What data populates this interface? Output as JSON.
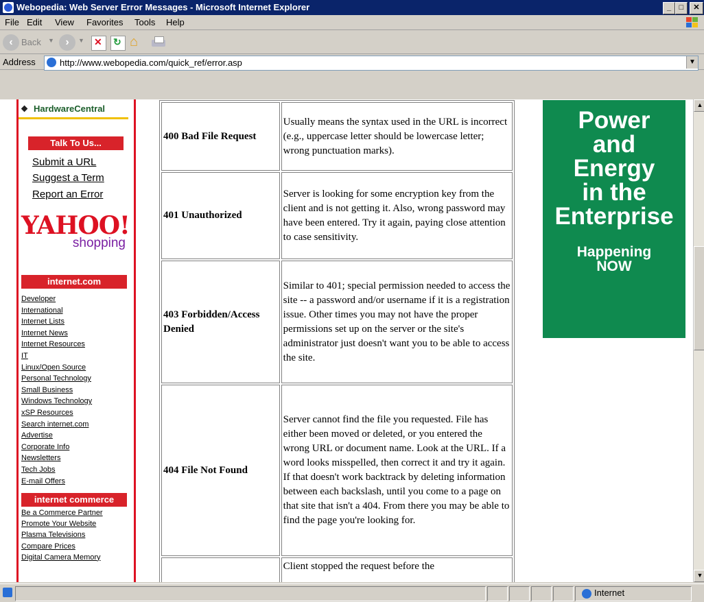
{
  "window": {
    "title": "Webopedia: Web Server Error Messages - Microsoft Internet Explorer"
  },
  "menu": [
    "File",
    "Edit",
    "View",
    "Favorites",
    "Tools",
    "Help"
  ],
  "toolbar": {
    "back_label": "Back"
  },
  "address": {
    "label": "Address",
    "url": "http://www.webopedia.com/quick_ref/error.asp"
  },
  "sidebar": {
    "hwc": "HardwareCentral",
    "talk_header": "Talk To Us...",
    "talk_links": [
      "Submit a URL",
      "Suggest a Term",
      "Report an Error"
    ],
    "yahoo": "YAHOO!",
    "yahoo_sub": "shopping",
    "internet_header": "internet.com",
    "internet_links": [
      "Developer",
      "International",
      "Internet Lists",
      "Internet News",
      "Internet Resources",
      "IT",
      "Linux/Open Source",
      "Personal Technology",
      "Small Business",
      "Windows Technology",
      "xSP Resources",
      "Search internet.com",
      "Advertise",
      "Corporate Info",
      "Newsletters",
      "Tech Jobs",
      "E-mail Offers"
    ],
    "commerce_header": "internet commerce",
    "commerce_links": [
      "Be a Commerce Partner",
      "Promote Your Website",
      "Plasma Televisions",
      "Compare Prices",
      "Digital Camera Memory"
    ]
  },
  "errors": [
    {
      "code": "400 Bad File Request",
      "desc": "Usually means the syntax used in the URL is incorrect (e.g., uppercase letter should be lowercase letter; wrong punctuation marks)."
    },
    {
      "code": "401 Unauthorized",
      "desc": "Server is looking for some encryption key from the client and is not getting it. Also, wrong password may have been entered. Try it again, paying close attention to case sensitivity."
    },
    {
      "code": "403 Forbidden/Access Denied",
      "desc": "Similar to 401; special permission needed to access the site -- a password and/or username if it is a registration issue. Other times you may not have the proper permissions set up on the server or the site's administrator just doesn't want you to be able to access the site."
    },
    {
      "code": "404 File Not Found",
      "desc": "Server cannot find the file you requested. File has either been moved or deleted, or you entered the wrong URL or document name. Look at the URL. If a word looks misspelled, then correct it and try it again. If that doesn't work backtrack by deleting information between each backslash, until you come to a page on that site that isn't a 404. From there you may be able to find the page you're looking for."
    },
    {
      "code": "",
      "desc": "Client stopped the request before the"
    }
  ],
  "ad": {
    "headline": [
      "Power",
      "and",
      "Energy",
      "in the",
      "Enterprise"
    ],
    "sub": [
      "Happening",
      "NOW"
    ]
  },
  "status": {
    "zone": "Internet"
  }
}
